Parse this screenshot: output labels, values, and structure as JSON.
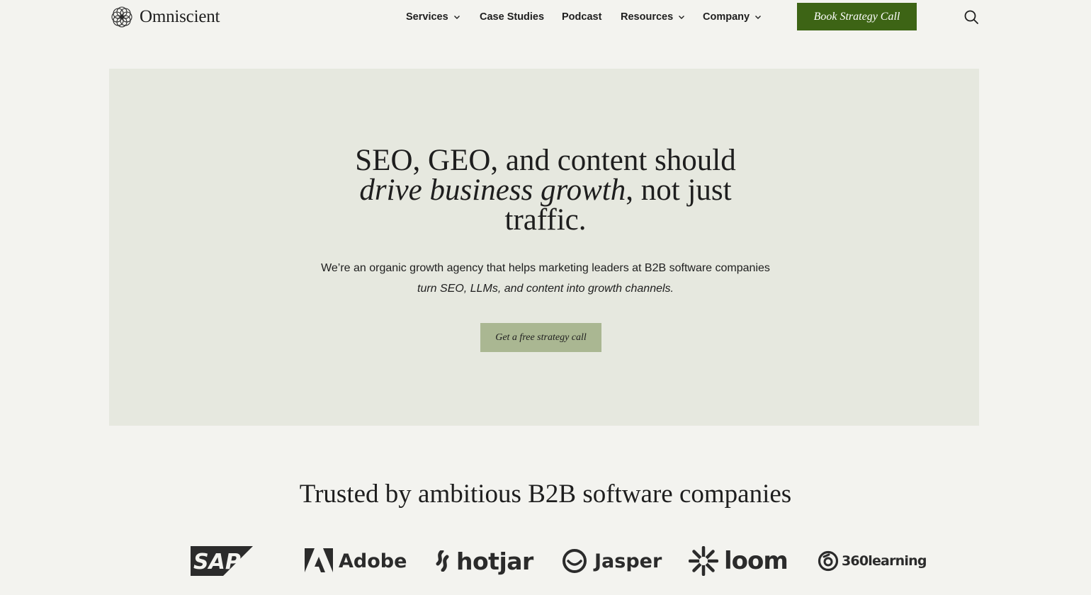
{
  "brand": {
    "name": "Omniscient",
    "logo_icon": "lattice-circle-icon"
  },
  "nav": {
    "items": [
      {
        "label": "Services",
        "dropdown": true
      },
      {
        "label": "Case Studies",
        "dropdown": false
      },
      {
        "label": "Podcast",
        "dropdown": false
      },
      {
        "label": "Resources",
        "dropdown": true
      },
      {
        "label": "Company",
        "dropdown": true
      }
    ],
    "cta_label": "Book Strategy Call",
    "search_icon": "search-icon"
  },
  "hero": {
    "title_line1": "SEO, GEO, and content should",
    "title_emphasis": "drive business growth",
    "title_rest": ", not just",
    "title_line3": "traffic.",
    "subtitle": "We’re an organic growth agency that helps marketing leaders at B2B software companies",
    "subtitle_emphasis": "turn SEO, LLMs, and content into growth channels.",
    "cta_label": "Get a free strategy call"
  },
  "trusted": {
    "title": "Trusted by ambitious B2B software companies",
    "logos": [
      {
        "name": "SAP",
        "icon": "sap-logo"
      },
      {
        "name": "Adobe",
        "icon": "adobe-logo"
      },
      {
        "name": "hotjar",
        "icon": "hotjar-logo"
      },
      {
        "name": "Jasper",
        "icon": "jasper-logo"
      },
      {
        "name": "loom",
        "icon": "loom-logo"
      },
      {
        "name": "360learning",
        "icon": "360learning-logo"
      }
    ]
  },
  "colors": {
    "page_bg": "#f3f3ef",
    "hero_bg": "#e6e8df",
    "primary_cta": "#3d6415",
    "secondary_cta": "#aab792",
    "text": "#1e1e1e"
  }
}
